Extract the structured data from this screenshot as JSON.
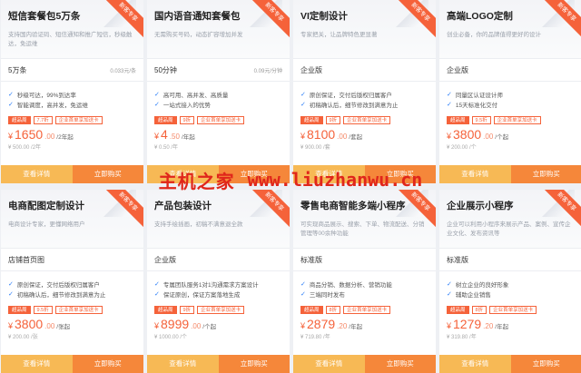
{
  "watermark": {
    "text_cn": "主机之家",
    "url": "www.liuzhanwu.cn"
  },
  "colors": {
    "accent": "#f5623a",
    "view_button": "#f7b955",
    "buy_button": "#f5873a",
    "check": "#2d7ff9"
  },
  "icons": {
    "feature_bullet": "check-icon"
  },
  "cards": [
    {
      "title": "短信套餐包5万条",
      "ribbon": "新客专享",
      "desc": "支持国内验证码、短信通知和推广短信，秒级触达，免运维",
      "spec": "5万条",
      "unit_price": "0.033元/条",
      "features": [
        "秒级可达，99%到达率",
        "智能调度，高并发，免运维"
      ],
      "tags": [
        "超品周",
        "7.7折",
        "企业首单享加送卡"
      ],
      "currency": "¥",
      "price": "1650",
      "price_dec": ".00",
      "per": "/2年起",
      "original": "¥ 500.00 /2年",
      "view": "查看详情",
      "buy": "立即购买"
    },
    {
      "title": "国内语音通知套餐包",
      "ribbon": "新客专享",
      "desc": "无需购买号码，动态扩容增加并发",
      "spec": "50分钟",
      "unit_price": "0.09元/分钟",
      "features": [
        "高可用、高并发、高质量",
        "一站式接入的优势"
      ],
      "tags": [
        "超品周",
        "9折",
        "企业首单享加送卡"
      ],
      "currency": "¥",
      "price": "4",
      "price_dec": ".50",
      "per": "/年起",
      "original": "¥ 0.50 /年",
      "view": "查看详情",
      "buy": "立即购买"
    },
    {
      "title": "VI定制设计",
      "ribbon": "新客专享",
      "desc": "专家把关，让品牌特色更显著",
      "spec": "企业版",
      "unit_price": "",
      "features": [
        "原创保证，交付后版权归属客户",
        "初稿确认后，细节修改到满意为止"
      ],
      "tags": [
        "超品周",
        "9折",
        "企业首单享加送卡"
      ],
      "currency": "¥",
      "price": "8100",
      "price_dec": ".00",
      "per": "/套起",
      "original": "¥ 900.00 /套",
      "view": "查看详情",
      "buy": "立即购买"
    },
    {
      "title": "高端LOGO定制",
      "ribbon": "新客专享",
      "desc": "创业必备，你的品牌值得更好的设计",
      "spec": "企业版",
      "unit_price": "",
      "features": [
        "同量区认证设计师",
        "15天标准化交付"
      ],
      "tags": [
        "超品周",
        "9.5折",
        "企业首单享加送卡"
      ],
      "currency": "¥",
      "price": "3800",
      "price_dec": ".00",
      "per": "/个起",
      "original": "¥ 200.00 /个",
      "view": "查看详情",
      "buy": "立即购买"
    },
    {
      "title": "电商配图定制设计",
      "ribbon": "新客专享",
      "desc": "电商设计专家，更懂网络用户",
      "spec": "店铺首页图",
      "unit_price": "",
      "features": [
        "原创保证，交付后版权归属客户",
        "初稿确认后，细节修改到满意为止"
      ],
      "tags": [
        "超品周",
        "9.5折",
        "企业首单享加送卡"
      ],
      "currency": "¥",
      "price": "3800",
      "price_dec": ".00",
      "per": "/张起",
      "original": "¥ 200.00 /张",
      "view": "查看详情",
      "buy": "立即购买"
    },
    {
      "title": "产品包装设计",
      "ribbon": "新客专享",
      "desc": "支持手绘插画，初稿不满意退全款",
      "spec": "企业版",
      "unit_price": "",
      "features": [
        "专属团队服务1对1沟通需求方案设计",
        "保证原创，保证方案落地生成"
      ],
      "tags": [
        "超品周",
        "9折",
        "企业首单享加送卡"
      ],
      "currency": "¥",
      "price": "8999",
      "price_dec": ".00",
      "per": "/个起",
      "original": "¥ 1000.00 /个",
      "view": "查看详情",
      "buy": "立即购买"
    },
    {
      "title": "零售电商智能多端小程序",
      "ribbon": "新客专享",
      "desc": "可实现商品展示、搜索、下单、物流配送、分销管理等00余种功能",
      "spec": "标准版",
      "unit_price": "",
      "features": [
        "商品分销、数据分析、营销功能",
        "三端同时发布"
      ],
      "tags": [
        "超品周",
        "8折",
        "企业首单享加送卡"
      ],
      "currency": "¥",
      "price": "2879",
      "price_dec": ".20",
      "per": "/年起",
      "original": "¥ 719.80 /年",
      "view": "查看详情",
      "buy": "立即购买"
    },
    {
      "title": "企业展示小程序",
      "ribbon": "新客专享",
      "desc": "企业可以利用小程序来展示产品、案例、宣传企业文化、发布资讯等",
      "spec": "标准版",
      "unit_price": "",
      "features": [
        "树立企业的良好形象",
        "辅助企业销售"
      ],
      "tags": [
        "超品周",
        "8折",
        "企业首单享加送卡"
      ],
      "currency": "¥",
      "price": "1279",
      "price_dec": ".20",
      "per": "/年起",
      "original": "¥ 319.80 /年",
      "view": "查看详情",
      "buy": "立即购买"
    }
  ]
}
